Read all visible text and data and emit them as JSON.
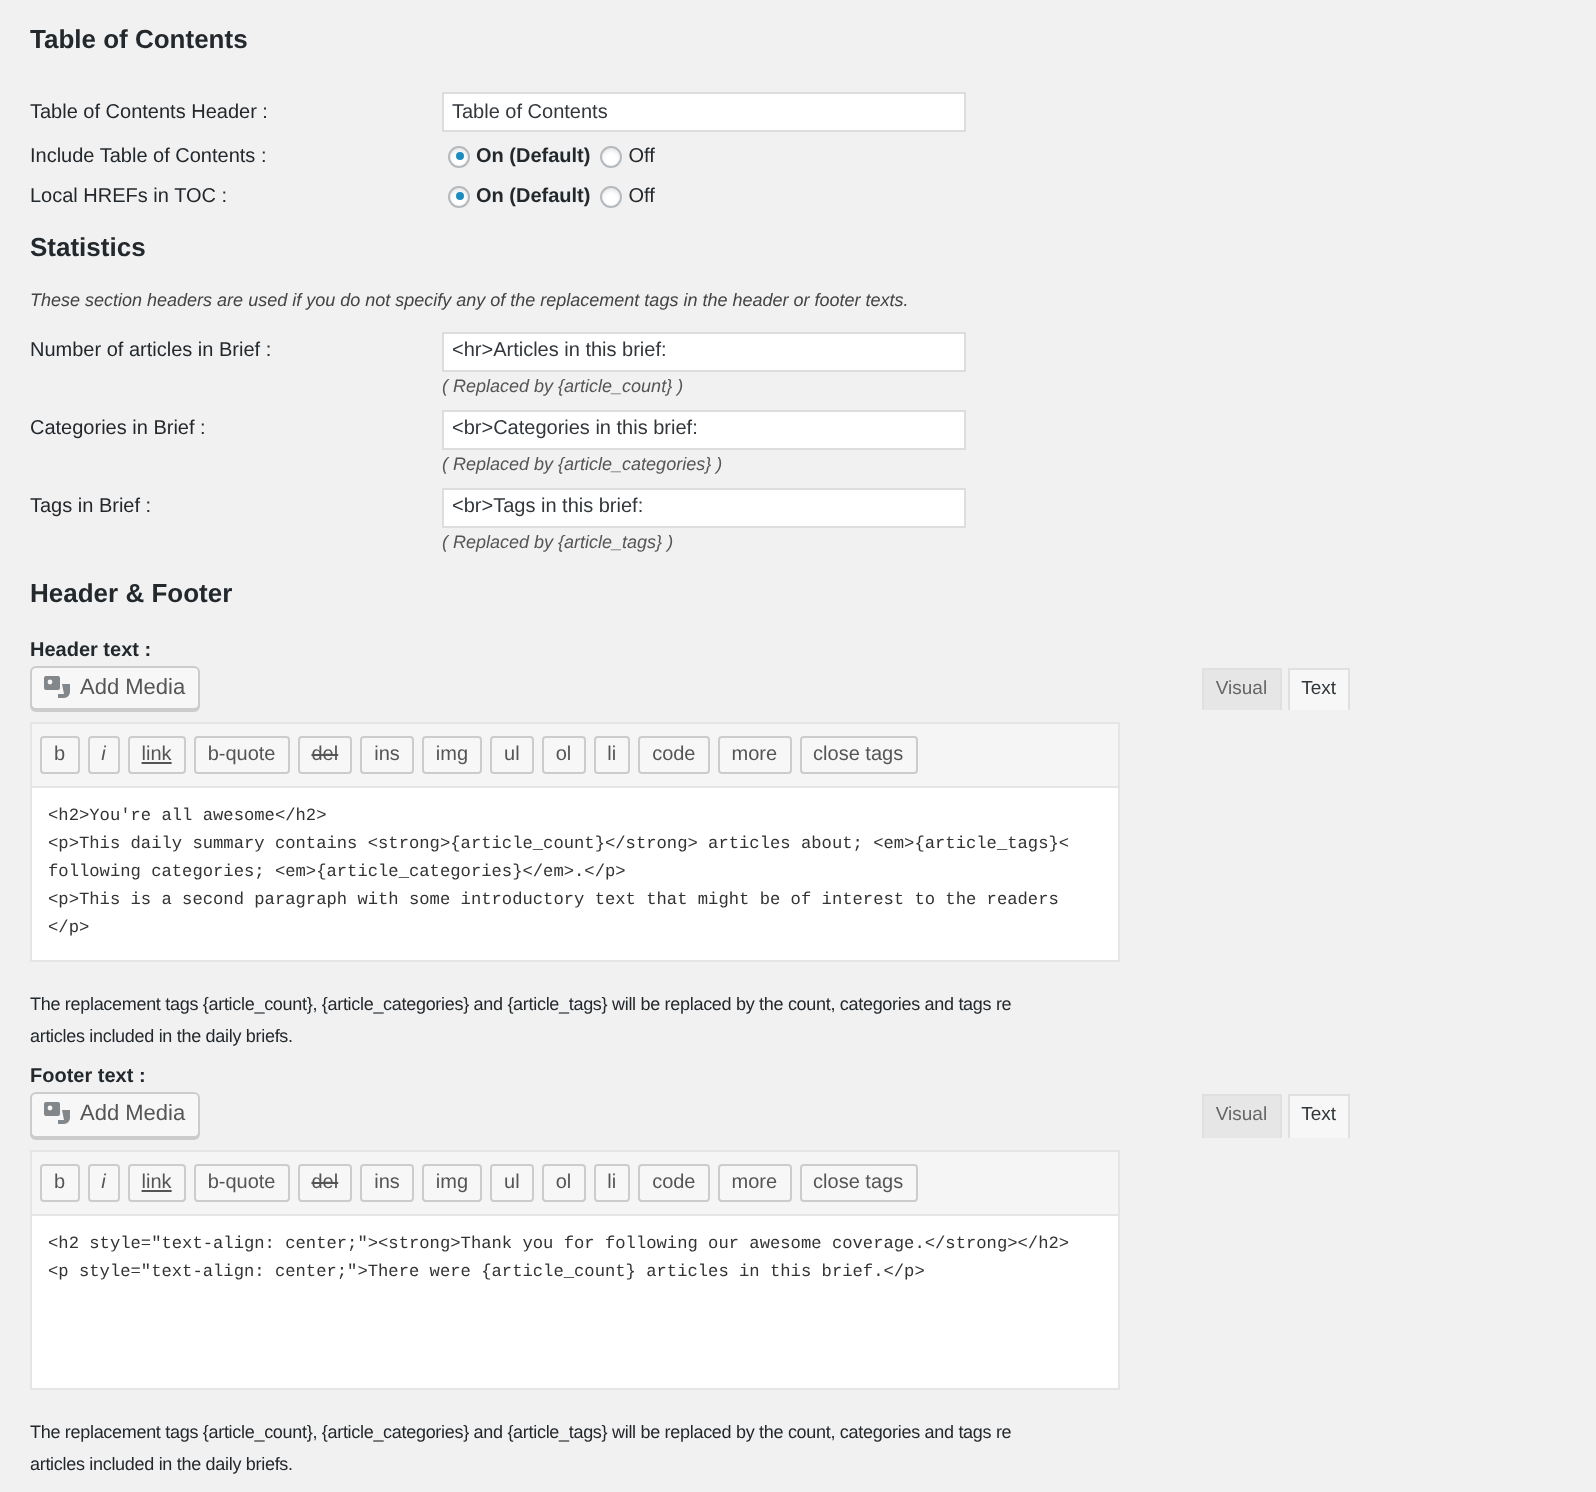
{
  "toc": {
    "heading": "Table of Contents",
    "fields": [
      {
        "kind": "text",
        "label": "Table of Contents Header :",
        "value": "Table of Contents"
      },
      {
        "kind": "radio",
        "label": "Include Table of Contents :",
        "options": [
          {
            "label": "On (Default)",
            "selected": true
          },
          {
            "label": "Off",
            "selected": false
          }
        ]
      },
      {
        "kind": "radio",
        "label": "Local HREFs in TOC :",
        "options": [
          {
            "label": "On (Default)",
            "selected": true
          },
          {
            "label": "Off",
            "selected": false
          }
        ]
      }
    ]
  },
  "statistics": {
    "heading": "Statistics",
    "note": "These section headers are used if you do not specify any of the replacement tags in the header or footer texts.",
    "fields": [
      {
        "label": "Number of articles in Brief :",
        "value": "<hr>Articles in this brief:",
        "hint": "( Replaced by {article_count} )"
      },
      {
        "label": "Categories in Brief :",
        "value": "<br>Categories in this brief:",
        "hint": "( Replaced by {article_categories} )"
      },
      {
        "label": "Tags in Brief :",
        "value": "<br>Tags in this brief:",
        "hint": "( Replaced by {article_tags} )"
      }
    ]
  },
  "header_footer": {
    "heading": "Header & Footer",
    "editors": [
      {
        "label": "Header text :",
        "add_media": "Add Media",
        "tabs": [
          {
            "label": "Visual",
            "selected": false
          },
          {
            "label": "Text",
            "selected": true
          }
        ],
        "toolbar": [
          {
            "label": "b",
            "kind": "plain"
          },
          {
            "label": "i",
            "kind": "italic"
          },
          {
            "label": "link",
            "kind": "link"
          },
          {
            "label": "b-quote",
            "kind": "plain"
          },
          {
            "label": "del",
            "kind": "del"
          },
          {
            "label": "ins",
            "kind": "plain"
          },
          {
            "label": "img",
            "kind": "plain"
          },
          {
            "label": "ul",
            "kind": "plain"
          },
          {
            "label": "ol",
            "kind": "plain"
          },
          {
            "label": "li",
            "kind": "plain"
          },
          {
            "label": "code",
            "kind": "plain"
          },
          {
            "label": "more",
            "kind": "plain"
          },
          {
            "label": "close tags",
            "kind": "plain"
          }
        ],
        "code_lines": [
          "<h2>You're all awesome</h2>",
          "<p>This daily summary contains <strong>{article_count}</strong> articles about; <em>{article_tags}<",
          "following categories; <em>{article_categories}</em>.</p>",
          "<p>This is a second paragraph with some introductory text that might be of interest to the readers",
          "</p>"
        ],
        "note_lines": [
          "The replacement tags {article_count}, {article_categories} and {article_tags} will be replaced by the count, categories and tags re",
          "articles included in the daily briefs."
        ]
      },
      {
        "label": "Footer text :",
        "add_media": "Add Media",
        "tabs": [
          {
            "label": "Visual",
            "selected": false
          },
          {
            "label": "Text",
            "selected": true
          }
        ],
        "toolbar": [
          {
            "label": "b",
            "kind": "plain"
          },
          {
            "label": "i",
            "kind": "italic"
          },
          {
            "label": "link",
            "kind": "link"
          },
          {
            "label": "b-quote",
            "kind": "plain"
          },
          {
            "label": "del",
            "kind": "del"
          },
          {
            "label": "ins",
            "kind": "plain"
          },
          {
            "label": "img",
            "kind": "plain"
          },
          {
            "label": "ul",
            "kind": "plain"
          },
          {
            "label": "ol",
            "kind": "plain"
          },
          {
            "label": "li",
            "kind": "plain"
          },
          {
            "label": "code",
            "kind": "plain"
          },
          {
            "label": "more",
            "kind": "plain"
          },
          {
            "label": "close tags",
            "kind": "plain"
          }
        ],
        "code_lines": [
          "<h2 style=\"text-align: center;\"><strong>Thank you for following our awesome coverage.</strong></h2>",
          "<p style=\"text-align: center;\">There were {article_count} articles in this brief.</p>"
        ],
        "note_lines": [
          "The replacement tags {article_count}, {article_categories} and {article_tags} will be replaced by the count, categories and tags re",
          "articles included in the daily briefs."
        ]
      }
    ]
  }
}
